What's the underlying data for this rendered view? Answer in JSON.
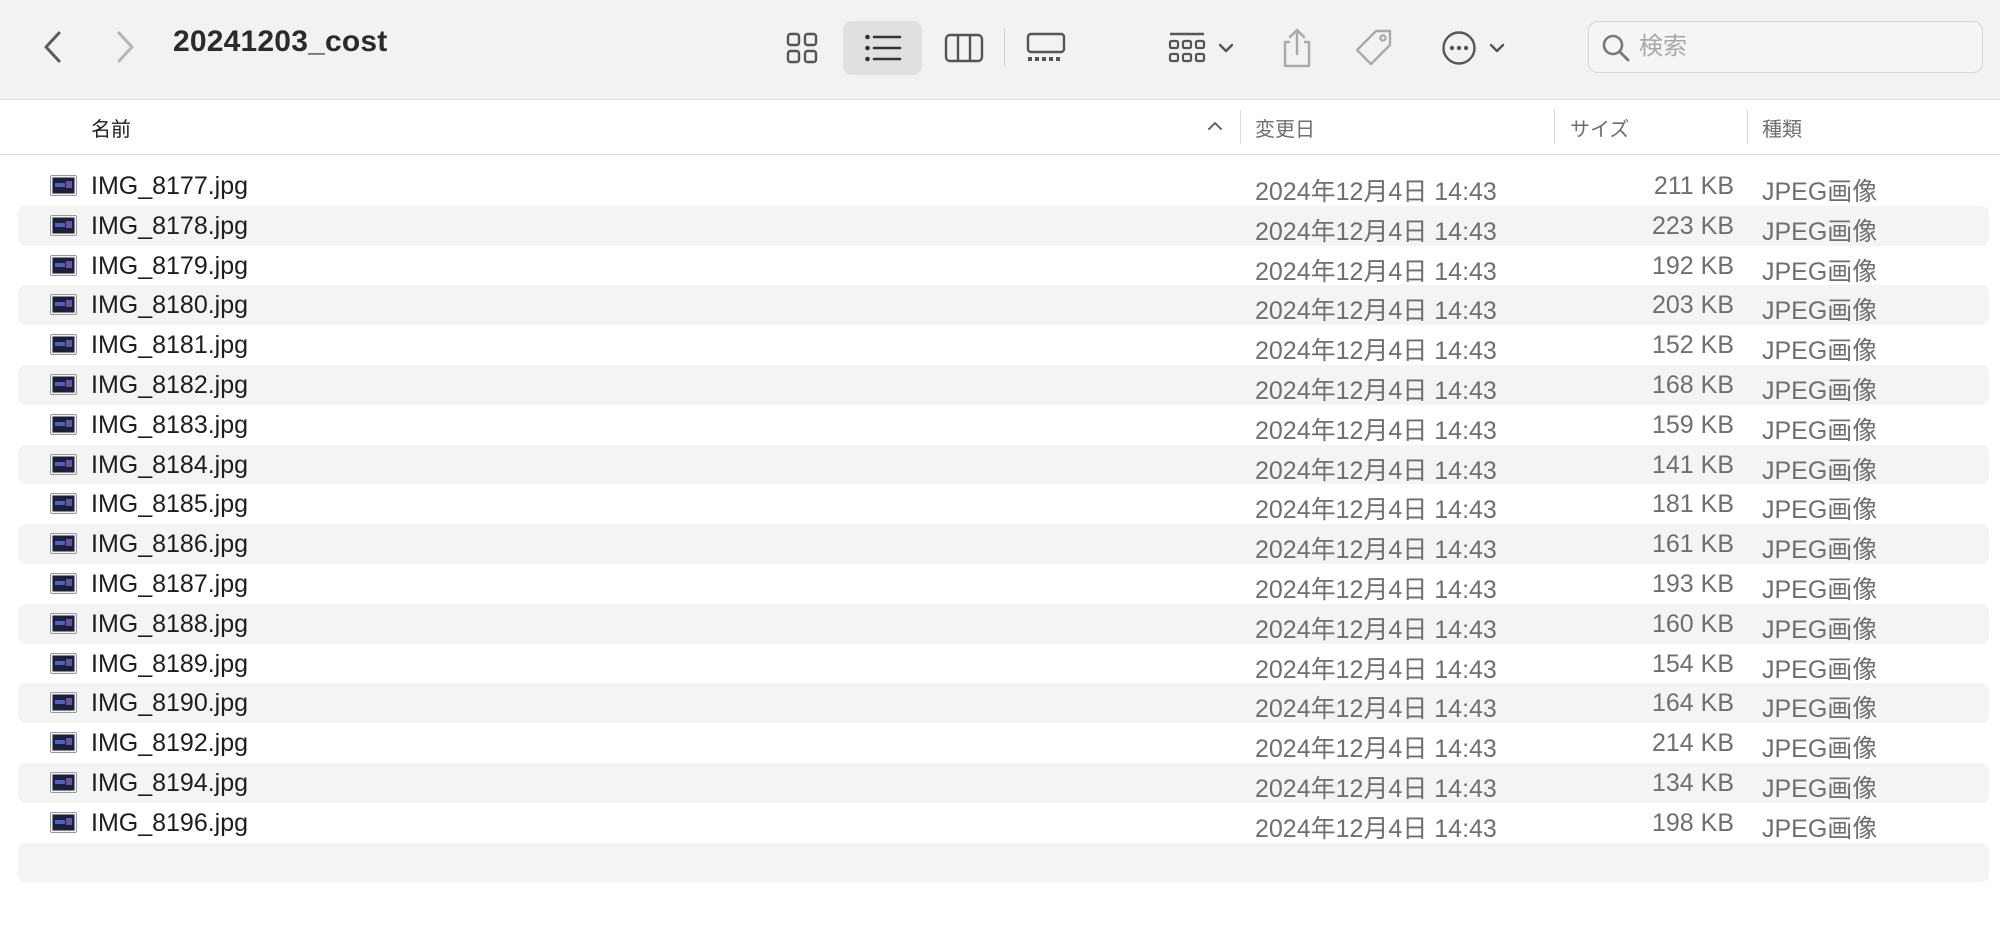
{
  "window": {
    "title": "20241203_cost"
  },
  "toolbar": {
    "back_icon": "chevron-left-icon",
    "forward_icon": "chevron-right-icon",
    "views": [
      "icon-view-icon",
      "list-view-icon",
      "column-view-icon",
      "gallery-view-icon"
    ],
    "active_view": "list",
    "group_icon": "group-icon",
    "share_icon": "share-icon",
    "tag_icon": "tag-icon",
    "more_icon": "ellipsis-circle-icon"
  },
  "search": {
    "placeholder": "検索",
    "value": ""
  },
  "columns": {
    "name": "名前",
    "modified": "変更日",
    "size": "サイズ",
    "kind": "種類"
  },
  "files": [
    {
      "name": "IMG_8177.jpg",
      "modified": "2024年12月4日 14:43",
      "size": "211 KB",
      "kind": "JPEG画像"
    },
    {
      "name": "IMG_8178.jpg",
      "modified": "2024年12月4日 14:43",
      "size": "223 KB",
      "kind": "JPEG画像"
    },
    {
      "name": "IMG_8179.jpg",
      "modified": "2024年12月4日 14:43",
      "size": "192 KB",
      "kind": "JPEG画像"
    },
    {
      "name": "IMG_8180.jpg",
      "modified": "2024年12月4日 14:43",
      "size": "203 KB",
      "kind": "JPEG画像"
    },
    {
      "name": "IMG_8181.jpg",
      "modified": "2024年12月4日 14:43",
      "size": "152 KB",
      "kind": "JPEG画像"
    },
    {
      "name": "IMG_8182.jpg",
      "modified": "2024年12月4日 14:43",
      "size": "168 KB",
      "kind": "JPEG画像"
    },
    {
      "name": "IMG_8183.jpg",
      "modified": "2024年12月4日 14:43",
      "size": "159 KB",
      "kind": "JPEG画像"
    },
    {
      "name": "IMG_8184.jpg",
      "modified": "2024年12月4日 14:43",
      "size": "141 KB",
      "kind": "JPEG画像"
    },
    {
      "name": "IMG_8185.jpg",
      "modified": "2024年12月4日 14:43",
      "size": "181 KB",
      "kind": "JPEG画像"
    },
    {
      "name": "IMG_8186.jpg",
      "modified": "2024年12月4日 14:43",
      "size": "161 KB",
      "kind": "JPEG画像"
    },
    {
      "name": "IMG_8187.jpg",
      "modified": "2024年12月4日 14:43",
      "size": "193 KB",
      "kind": "JPEG画像"
    },
    {
      "name": "IMG_8188.jpg",
      "modified": "2024年12月4日 14:43",
      "size": "160 KB",
      "kind": "JPEG画像"
    },
    {
      "name": "IMG_8189.jpg",
      "modified": "2024年12月4日 14:43",
      "size": "154 KB",
      "kind": "JPEG画像"
    },
    {
      "name": "IMG_8190.jpg",
      "modified": "2024年12月4日 14:43",
      "size": "164 KB",
      "kind": "JPEG画像"
    },
    {
      "name": "IMG_8192.jpg",
      "modified": "2024年12月4日 14:43",
      "size": "214 KB",
      "kind": "JPEG画像"
    },
    {
      "name": "IMG_8194.jpg",
      "modified": "2024年12月4日 14:43",
      "size": "134 KB",
      "kind": "JPEG画像"
    },
    {
      "name": "IMG_8196.jpg",
      "modified": "2024年12月4日 14:43",
      "size": "198 KB",
      "kind": "JPEG画像"
    }
  ],
  "colors": {
    "toolbar_bg": "#f3f2f1",
    "row_alt_bg": "#f4f4f5",
    "secondary_text": "#6e6e73",
    "primary_text": "#1d1d1f"
  }
}
